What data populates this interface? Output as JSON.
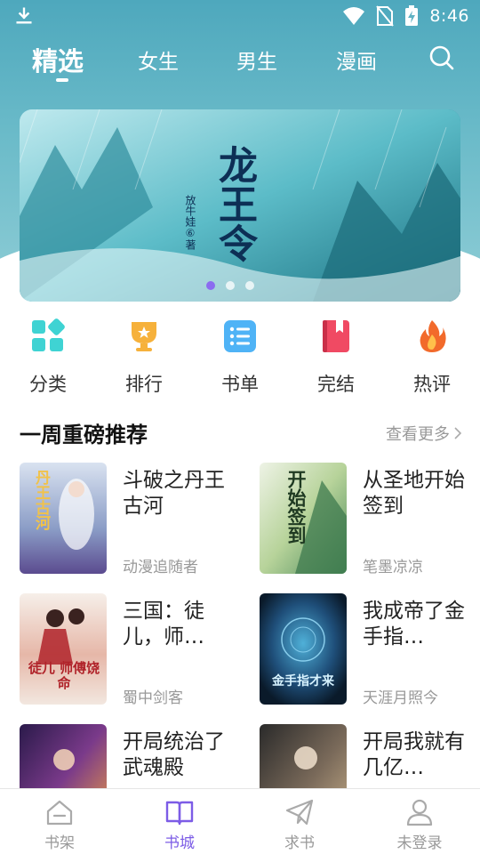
{
  "status_bar": {
    "time": "8:46"
  },
  "top_tabs": [
    {
      "label": "精选",
      "active": true
    },
    {
      "label": "女生",
      "active": false
    },
    {
      "label": "男生",
      "active": false
    },
    {
      "label": "漫画",
      "active": false
    }
  ],
  "banner": {
    "title_art": "龙王令",
    "author_art": "放牛娃⑥著",
    "slide_count": 3,
    "active_slide": 1
  },
  "categories": [
    {
      "label": "分类",
      "icon": "category-grid-icon",
      "color": "#3fd3d3"
    },
    {
      "label": "排行",
      "icon": "trophy-icon",
      "color": "#f6b13b"
    },
    {
      "label": "书单",
      "icon": "list-icon",
      "color": "#4fb3f6"
    },
    {
      "label": "完结",
      "icon": "bookmark-book-icon",
      "color": "#f04a63"
    },
    {
      "label": "热评",
      "icon": "flame-icon",
      "color": "#f26a2b"
    }
  ],
  "section": {
    "title": "一周重磅推荐",
    "more": "查看更多"
  },
  "books": [
    {
      "title": "斗破之丹王古河",
      "author": "动漫追随者"
    },
    {
      "title": "从圣地开始签到",
      "author": "笔墨凉凉"
    },
    {
      "title": "三国：徒儿，师…",
      "author": "蜀中剑客"
    },
    {
      "title": "我成帝了金手指…",
      "author": "天涯月照今"
    },
    {
      "title": "开局统治了武魂殿",
      "author": ""
    },
    {
      "title": "开局我就有几亿…",
      "author": ""
    }
  ],
  "covers": [
    {
      "art_text": "丹王古河",
      "colors": [
        "#d9e2f0",
        "#8a9cc6",
        "#5b4b8f"
      ]
    },
    {
      "art_text": "开始签到",
      "colors": [
        "#eef3e6",
        "#b7d39a",
        "#4a8a5a"
      ]
    },
    {
      "art_text": "徒儿 师傅饶命",
      "colors": [
        "#f6efe9",
        "#e6b7a8",
        "#b0232a"
      ]
    },
    {
      "art_text": "金手指才来",
      "colors": [
        "#0a1a2a",
        "#1f4f7a",
        "#4fb0d8"
      ]
    },
    {
      "art_text": "",
      "colors": [
        "#2a1a4a",
        "#7a3a8a",
        "#f0a040"
      ]
    },
    {
      "art_text": "",
      "colors": [
        "#2a2a2a",
        "#7a6a5a",
        "#c9b08a"
      ]
    }
  ],
  "bottom_nav": [
    {
      "label": "书架",
      "icon": "bookshelf-icon",
      "active": false
    },
    {
      "label": "书城",
      "icon": "open-book-icon",
      "active": true
    },
    {
      "label": "求书",
      "icon": "paper-plane-icon",
      "active": false
    },
    {
      "label": "未登录",
      "icon": "user-icon",
      "active": false
    }
  ],
  "colors": {
    "accent": "#7c5ce6",
    "header": "#4ea8bd"
  }
}
